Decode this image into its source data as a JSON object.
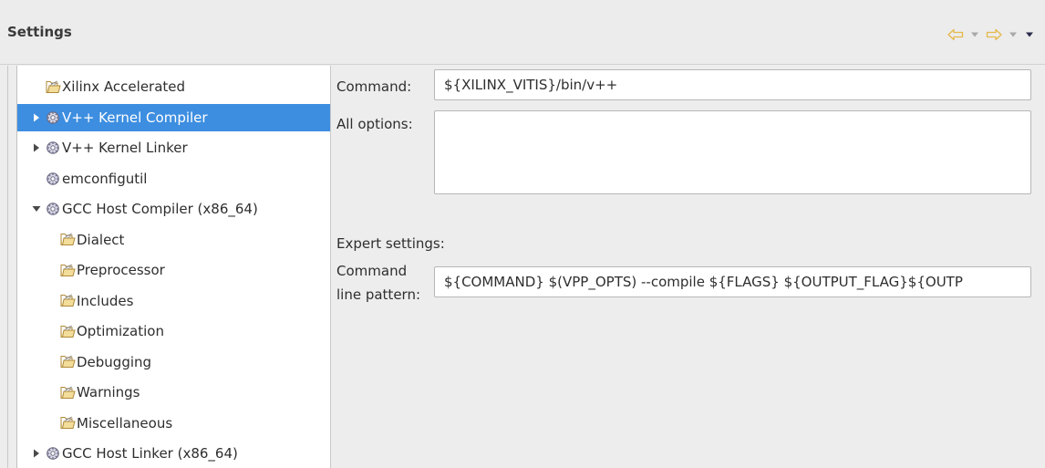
{
  "header": {
    "title": "Settings",
    "nav": {
      "back_icon": "back-arrow-icon",
      "forward_icon": "forward-arrow-icon",
      "menu_icon": "view-menu-icon"
    }
  },
  "tree": {
    "items": [
      {
        "label": "Xilinx Accelerated",
        "icon": "folder-icon",
        "expander": "none",
        "indent": 0,
        "selected": false
      },
      {
        "label": "V++ Kernel Compiler",
        "icon": "tool-icon",
        "expander": "collapsed",
        "indent": 0,
        "selected": true
      },
      {
        "label": "V++ Kernel Linker",
        "icon": "tool-icon",
        "expander": "collapsed",
        "indent": 0,
        "selected": false
      },
      {
        "label": "emconfigutil",
        "icon": "tool-icon",
        "expander": "none",
        "indent": 0,
        "selected": false
      },
      {
        "label": "GCC Host Compiler (x86_64)",
        "icon": "tool-icon",
        "expander": "expanded",
        "indent": 0,
        "selected": false
      },
      {
        "label": "Dialect",
        "icon": "folder-icon",
        "expander": "none",
        "indent": 1,
        "selected": false
      },
      {
        "label": "Preprocessor",
        "icon": "folder-icon",
        "expander": "none",
        "indent": 1,
        "selected": false
      },
      {
        "label": "Includes",
        "icon": "folder-icon",
        "expander": "none",
        "indent": 1,
        "selected": false
      },
      {
        "label": "Optimization",
        "icon": "folder-icon",
        "expander": "none",
        "indent": 1,
        "selected": false
      },
      {
        "label": "Debugging",
        "icon": "folder-icon",
        "expander": "none",
        "indent": 1,
        "selected": false
      },
      {
        "label": "Warnings",
        "icon": "folder-icon",
        "expander": "none",
        "indent": 1,
        "selected": false
      },
      {
        "label": "Miscellaneous",
        "icon": "folder-icon",
        "expander": "none",
        "indent": 1,
        "selected": false
      },
      {
        "label": "GCC Host Linker (x86_64)",
        "icon": "tool-icon",
        "expander": "collapsed",
        "indent": 0,
        "selected": false
      }
    ]
  },
  "form": {
    "command_label": "Command:",
    "command_value": "${XILINX_VITIS}/bin/v++",
    "all_options_label": "All options:",
    "all_options_value": "",
    "expert_settings_label": "Expert settings:",
    "pattern_label_line1": "Command",
    "pattern_label_line2": "line pattern:",
    "pattern_value": "${COMMAND} $(VPP_OPTS) --compile ${FLAGS} ${OUTPUT_FLAG}${OUTP"
  },
  "colors": {
    "selection": "#3d8ee0",
    "nav_arrow": "#e6b84a",
    "background": "#ededed"
  }
}
